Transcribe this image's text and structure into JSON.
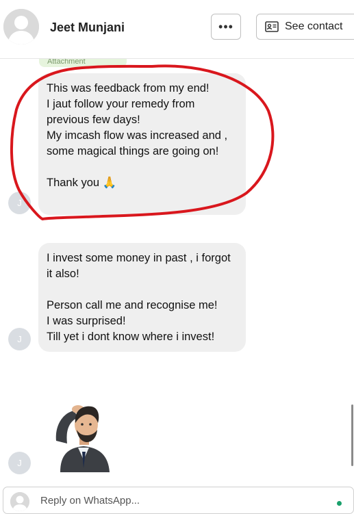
{
  "header": {
    "contact_name": "Jeet Munjani",
    "more_label": "•••",
    "see_contact_label": "See contact"
  },
  "messages": [
    {
      "avatar_initial": "J",
      "lines": [
        "This was feedback from my end!",
        "I jaut follow your remedy from previous few days!",
        "My imcash flow was increased and , some magical things are going on!",
        "",
        "Thank you 🙏"
      ]
    },
    {
      "avatar_initial": "J",
      "lines": [
        "I invest some money in past , i forgot it also!",
        "",
        "Person call me and recognise me!",
        "I was surprised!",
        "Till yet i dont know where i invest!"
      ]
    },
    {
      "avatar_initial": "J",
      "sticker": "saluting-man-sticker"
    }
  ],
  "attachment_label": "Attachment",
  "reply": {
    "placeholder": "Reply on WhatsApp..."
  },
  "colors": {
    "bubble": "#efefef",
    "annotation_red": "#d9171d",
    "online": "#1aa06c"
  }
}
